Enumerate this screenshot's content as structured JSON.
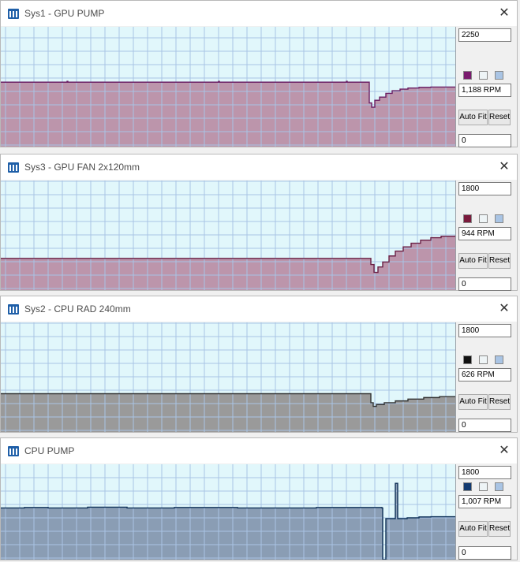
{
  "windows": [
    {
      "title": "Sys1 - GPU PUMP",
      "scale_max": "2250",
      "scale_min": "0",
      "current": "1,188 RPM",
      "buttons": {
        "auto_fit": "Auto Fit",
        "reset": "Reset"
      },
      "line_color": "#6a1f64",
      "fill_color": "#bc95ab",
      "swatches": [
        "#7a1a6e",
        "#eef4f6",
        "#a9c4e4"
      ],
      "ylim": [
        0,
        2250
      ],
      "series": [
        [
          0,
          1210
        ],
        [
          84,
          1225
        ],
        [
          85,
          1210
        ],
        [
          276,
          1225
        ],
        [
          277,
          1210
        ],
        [
          438,
          1225
        ],
        [
          439,
          1210
        ],
        [
          466,
          1210
        ],
        [
          467,
          820
        ],
        [
          470,
          740
        ],
        [
          474,
          870
        ],
        [
          480,
          930
        ],
        [
          488,
          1000
        ],
        [
          496,
          1050
        ],
        [
          506,
          1080
        ],
        [
          516,
          1100
        ],
        [
          530,
          1112
        ],
        [
          545,
          1118
        ],
        [
          576,
          1120
        ]
      ]
    },
    {
      "title": "Sys3 - GPU FAN 2x120mm",
      "scale_max": "1800",
      "scale_min": "0",
      "current": "944 RPM",
      "buttons": {
        "auto_fit": "Auto Fit",
        "reset": "Reset"
      },
      "line_color": "#6a1f44",
      "fill_color": "#bc95ab",
      "swatches": [
        "#7a1a3c",
        "#eef4f6",
        "#a9c4e4"
      ],
      "ylim": [
        0,
        1800
      ],
      "series": [
        [
          0,
          520
        ],
        [
          468,
          520
        ],
        [
          469,
          420
        ],
        [
          473,
          290
        ],
        [
          478,
          380
        ],
        [
          484,
          460
        ],
        [
          492,
          560
        ],
        [
          500,
          640
        ],
        [
          510,
          710
        ],
        [
          520,
          770
        ],
        [
          532,
          820
        ],
        [
          545,
          860
        ],
        [
          558,
          885
        ],
        [
          576,
          895
        ]
      ]
    },
    {
      "title": "Sys2 - CPU RAD 240mm",
      "scale_max": "1800",
      "scale_min": "0",
      "current": "626 RPM",
      "buttons": {
        "auto_fit": "Auto Fit",
        "reset": "Reset"
      },
      "line_color": "#333333",
      "fill_color": "#9a9a9a",
      "swatches": [
        "#111111",
        "#eef4f6",
        "#a9c4e4"
      ],
      "ylim": [
        0,
        1800
      ],
      "series": [
        [
          0,
          628
        ],
        [
          468,
          628
        ],
        [
          469,
          480
        ],
        [
          472,
          420
        ],
        [
          476,
          450
        ],
        [
          486,
          480
        ],
        [
          500,
          510
        ],
        [
          516,
          540
        ],
        [
          536,
          565
        ],
        [
          556,
          580
        ],
        [
          576,
          590
        ]
      ]
    },
    {
      "title": "CPU PUMP",
      "scale_max": "1800",
      "scale_min": "0",
      "current": "1,007 RPM",
      "buttons": {
        "auto_fit": "Auto Fit",
        "reset": "Reset"
      },
      "line_color": "#0f3158",
      "fill_color": "#8a9db4",
      "swatches": [
        "#123a70",
        "#eef4f6",
        "#a9c4e4"
      ],
      "ylim": [
        0,
        1800
      ],
      "series": [
        [
          0,
          975
        ],
        [
          30,
          985
        ],
        [
          60,
          975
        ],
        [
          110,
          990
        ],
        [
          160,
          975
        ],
        [
          220,
          985
        ],
        [
          300,
          975
        ],
        [
          400,
          985
        ],
        [
          483,
          975
        ],
        [
          484,
          0
        ],
        [
          487,
          0
        ],
        [
          488,
          775
        ],
        [
          499,
          775
        ],
        [
          500,
          1440
        ],
        [
          502,
          1440
        ],
        [
          503,
          775
        ],
        [
          515,
          790
        ],
        [
          530,
          805
        ],
        [
          545,
          810
        ],
        [
          576,
          812
        ]
      ]
    }
  ]
}
